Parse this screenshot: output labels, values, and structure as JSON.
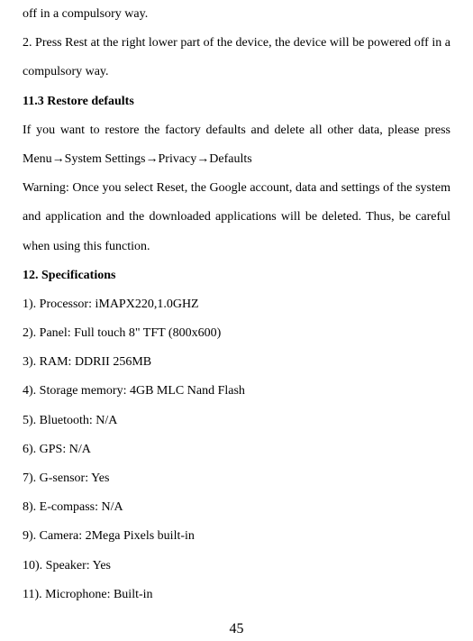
{
  "line1": "off in a compulsory way.",
  "line2": "2. Press Rest at the right lower part of the device, the device will be powered off in a compulsory way.",
  "heading1": "11.3 Restore defaults",
  "para1a": "If you want to restore the factory defaults and delete all other data, please press",
  "para1b": "Menu→System Settings→Privacy→Defaults",
  "para2": "Warning: Once you select Reset, the Google account, data and settings of the system and application and the downloaded applications will be deleted. Thus, be careful when using this function.",
  "heading2": "12. Specifications",
  "spec1": "1). Processor:    iMAPX220,1.0GHZ",
  "spec2": "2). Panel:    Full touch 8\" TFT (800x600)",
  "spec3": "3). RAM:    DDRII 256MB",
  "spec4": "4). Storage memory:    4GB MLC Nand Flash",
  "spec5": "5). Bluetooth:      N/A",
  "spec6": "6). GPS:              N/A",
  "spec7": "7). G-sensor:      Yes",
  "spec8": "8). E-compass:    N/A",
  "spec9": "9). Camera:    2Mega Pixels built-in",
  "spec10": "10). Speaker:        Yes",
  "spec11": "11). Microphone:    Built-in",
  "pageNum": "45"
}
